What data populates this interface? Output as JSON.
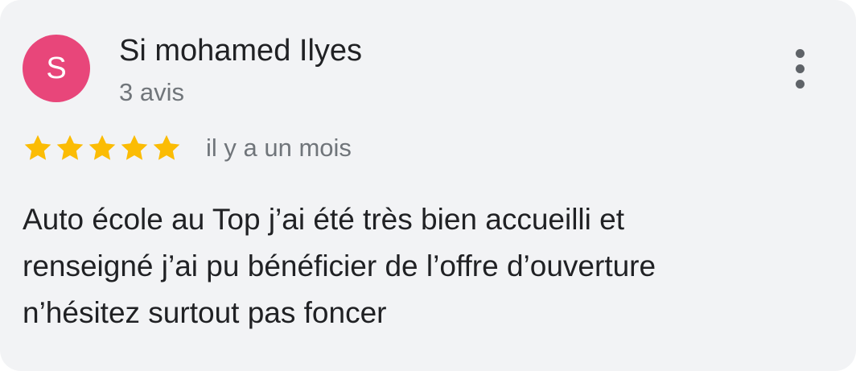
{
  "review": {
    "author": {
      "initial": "S",
      "name": "Si mohamed Ilyes",
      "review_count": "3 avis",
      "avatar_color": "#e8467a"
    },
    "rating": 5,
    "rating_max": 5,
    "star_color": "#fbbc04",
    "timestamp": "il y a un mois",
    "text_lines": [
      "Auto école au Top j’ai été très bien accueilli et",
      "renseigné j’ai pu bénéficier de l’offre d’ouverture",
      "n’hésitez surtout pas foncer"
    ],
    "more_icon": "more-vertical-icon"
  }
}
